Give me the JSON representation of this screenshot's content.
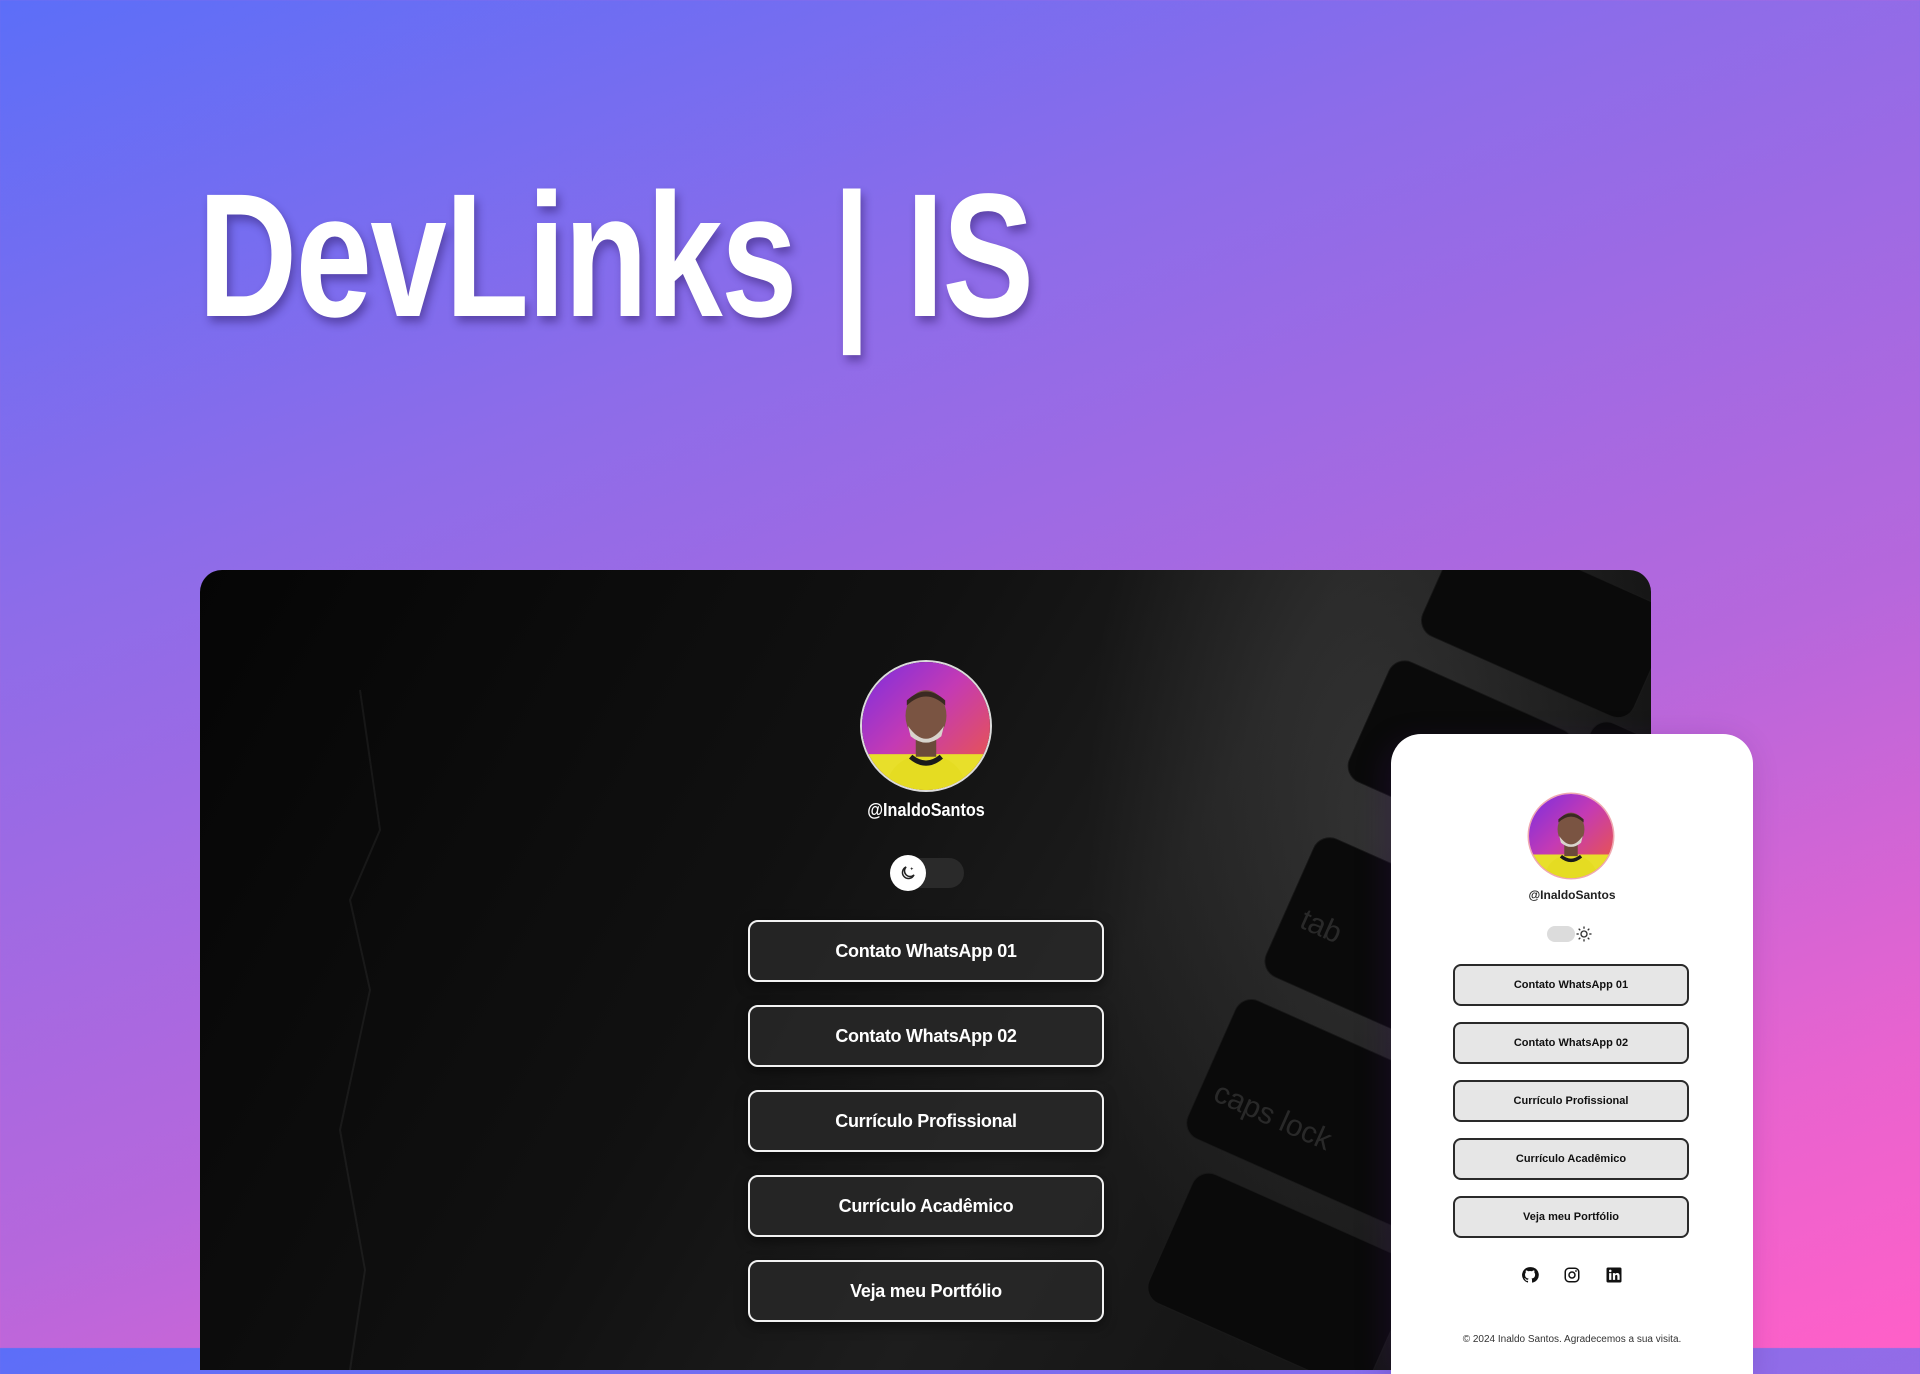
{
  "hero": {
    "title": "DevLinks | IS"
  },
  "desktop": {
    "username": "@InaldoSantos",
    "theme": "dark",
    "key_labels": [
      "tab",
      "caps lock"
    ],
    "links": [
      {
        "label": "Contato WhatsApp 01"
      },
      {
        "label": "Contato WhatsApp 02"
      },
      {
        "label": "Currículo Profissional"
      },
      {
        "label": "Currículo Acadêmico"
      },
      {
        "label": "Veja meu Portfólio"
      }
    ]
  },
  "mobile": {
    "username": "@InaldoSantos",
    "theme": "light",
    "links": [
      {
        "label": "Contato WhatsApp 01"
      },
      {
        "label": "Contato WhatsApp 02"
      },
      {
        "label": "Currículo Profissional"
      },
      {
        "label": "Currículo Acadêmico"
      },
      {
        "label": "Veja meu Portfólio"
      }
    ],
    "social_icons": [
      "github-icon",
      "instagram-icon",
      "linkedin-icon"
    ],
    "footer": "© 2024 Inaldo Santos. Agradecemos a sua visita."
  },
  "colors": {
    "background_start": "#5c6ef8",
    "background_end": "#ff60c8",
    "desktop_bg": "#0b0b0b",
    "mobile_bg": "#ffffff",
    "mobile_button_bg": "#e6e6e6"
  }
}
